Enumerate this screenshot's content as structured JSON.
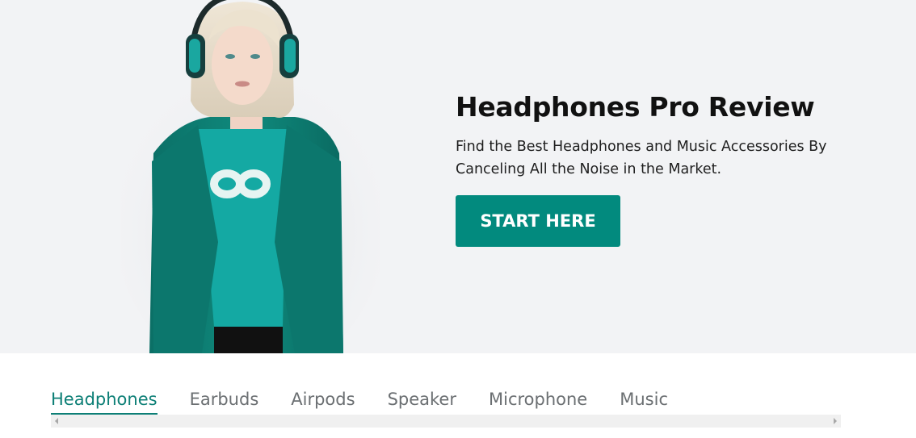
{
  "hero": {
    "title": "Headphones Pro Review",
    "subtitle": "Find the Best Headphones and Music Accessories By Canceling All the Noise in the Market.",
    "cta_label": "START HERE",
    "background_color": "#f2f3f5",
    "accent_color": "#028a7e"
  },
  "tabs": [
    {
      "label": "Headphones",
      "active": true
    },
    {
      "label": "Earbuds",
      "active": false
    },
    {
      "label": "Airpods",
      "active": false
    },
    {
      "label": "Speaker",
      "active": false
    },
    {
      "label": "Microphone",
      "active": false
    },
    {
      "label": "Music",
      "active": false
    }
  ],
  "scrollbar": {
    "left_arrow_icon": "chevron-left-icon",
    "right_arrow_icon": "chevron-right-icon"
  }
}
